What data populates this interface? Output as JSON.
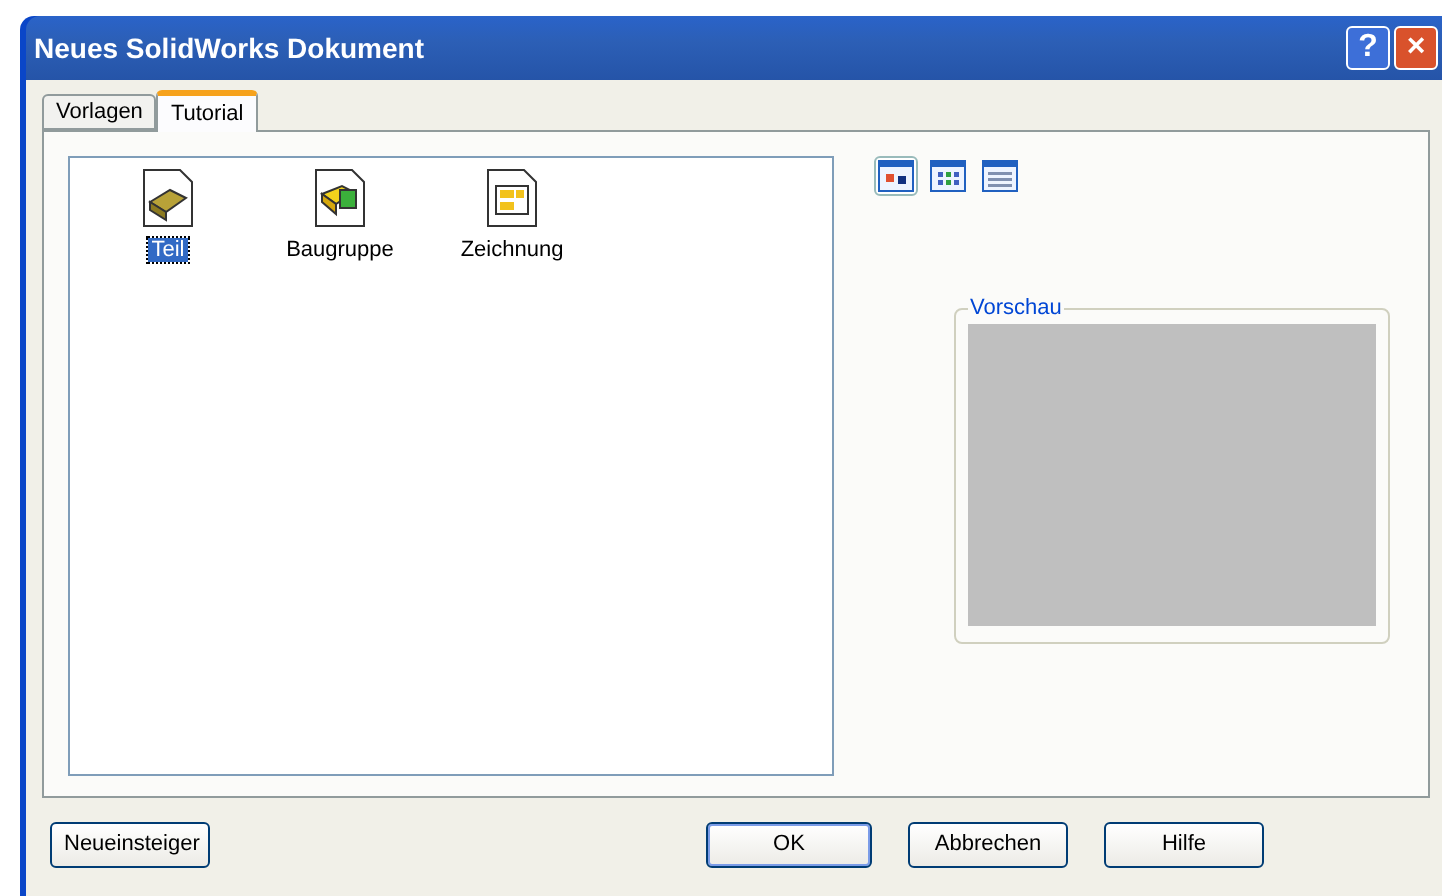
{
  "window": {
    "title": "Neues SolidWorks Dokument",
    "title_buttons": [
      "?",
      "×"
    ]
  },
  "tabs": [
    {
      "label": "Vorlagen",
      "selected": false
    },
    {
      "label": "Tutorial",
      "selected": true
    }
  ],
  "templates": [
    {
      "label": "Teil",
      "kind": "part",
      "selected": true
    },
    {
      "label": "Baugruppe",
      "kind": "assembly",
      "selected": false
    },
    {
      "label": "Zeichnung",
      "kind": "drawing",
      "selected": false
    }
  ],
  "view_modes": [
    {
      "kind": "large",
      "selected": true
    },
    {
      "kind": "list",
      "selected": false
    },
    {
      "kind": "details",
      "selected": false
    }
  ],
  "preview": {
    "label": "Vorschau"
  },
  "buttons": [
    {
      "label": "Neueinsteiger",
      "default": false
    },
    {
      "label": "OK",
      "default": true
    },
    {
      "label": "Abbrechen",
      "default": false
    },
    {
      "label": "Hilfe",
      "default": false
    }
  ]
}
